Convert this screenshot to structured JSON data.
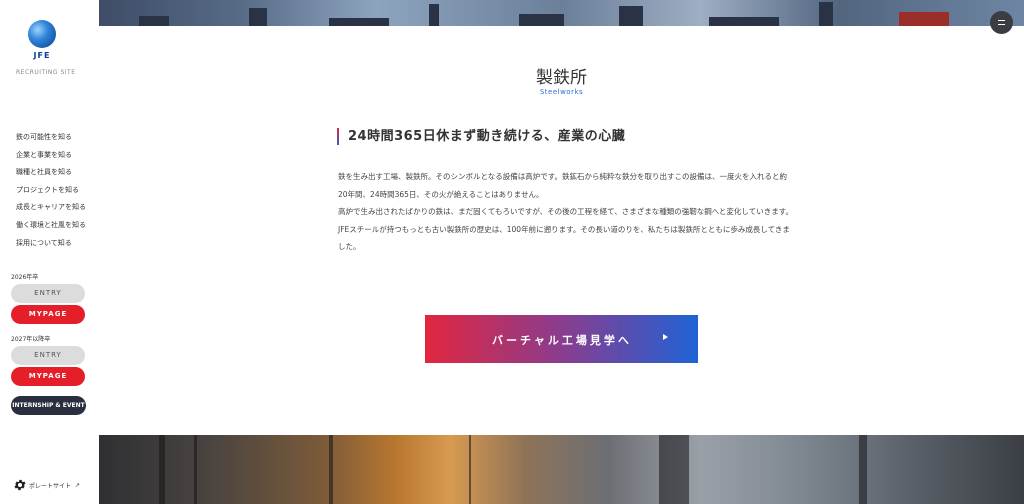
{
  "sidebar": {
    "logo_text": "JFE",
    "recruiting_label": "RECRUITING SITE",
    "nav": [
      {
        "label": "鉄の可能性を知る"
      },
      {
        "label": "企業と事業を知る"
      },
      {
        "label": "職種と社員を知る"
      },
      {
        "label": "プロジェクトを知る"
      },
      {
        "label": "成長とキャリアを知る"
      },
      {
        "label": "働く環境と社風を知る"
      },
      {
        "label": "採用について知る"
      }
    ],
    "year_2026": "2026年卒",
    "entry_label": "ENTRY",
    "mypage_label": "MYPAGE",
    "year_2027": "2027年以降卒",
    "entry2_label": "ENTRY",
    "mypage2_label": "MYPAGE",
    "internship_label": "INTERNSHIP & EVENT",
    "corporate_label": "ポレートサイト"
  },
  "main": {
    "title": "製鉄所",
    "subtitle": "Steelworks",
    "section_heading": "24時間365日休まず動き続ける、産業の心臓",
    "paragraphs": [
      "鉄を生み出す工場、製鉄所。そのシンボルとなる設備は高炉です。鉄鉱石から純粋な鉄分を取り出すこの設備は、一度火を入れると約20年間、24時間365日、その火が絶えることはありません。",
      "高炉で生み出されたばかりの鉄は、まだ固くてもろいですが、その後の工程を経て、さまざまな種類の強靭な鋼へと変化していきます。",
      "JFEスチールが持つもっとも古い製鉄所の歴史は、100年前に遡ります。その長い道のりを、私たちは製鉄所とともに歩み成長してきました。"
    ],
    "cta_label": "バーチャル工場見学へ"
  },
  "colors": {
    "accent_red": "#e51f2a",
    "accent_blue": "#2d6fd6",
    "internship_bg": "#2b2e3f"
  }
}
